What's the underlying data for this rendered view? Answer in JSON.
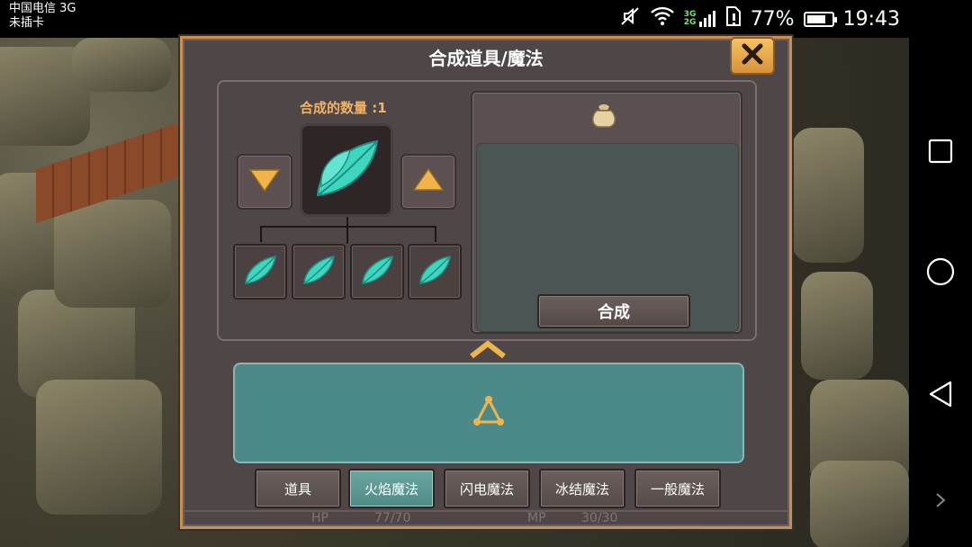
{
  "status_bar": {
    "carrier_line1": "中国电信 3G",
    "carrier_line2": "未插卡",
    "network_label": "3G 2G",
    "battery_percent": "77%",
    "battery_level": 0.77,
    "time": "19:43"
  },
  "dialog": {
    "title": "合成道具/魔法",
    "count_label": "合成的数量 :1",
    "compose_button": "合成",
    "tabs": [
      {
        "label": "道具",
        "active": false
      },
      {
        "label": "火焰魔法",
        "active": true
      },
      {
        "label": "闪电魔法",
        "active": false
      },
      {
        "label": "冰结魔法",
        "active": false
      },
      {
        "label": "一般魔法",
        "active": false
      }
    ]
  },
  "hud": {
    "hp_label": "HP",
    "hp_value": "77/70",
    "mp_label": "MP",
    "mp_value": "30/30"
  },
  "colors": {
    "dialog_bg": "#4f4647",
    "border_gold": "#c78e56",
    "leaf": "#3fd6c0",
    "active_tab": "#5a9894",
    "list_area": "#4b8a88",
    "arrow": "#f0b54a"
  },
  "icons": [
    "close-icon",
    "arrow-down-icon",
    "arrow-up-icon",
    "leaf-icon",
    "bag-icon",
    "chevron-up-icon",
    "triangle-node-icon",
    "square-nav-icon",
    "circle-nav-icon",
    "back-nav-icon"
  ]
}
